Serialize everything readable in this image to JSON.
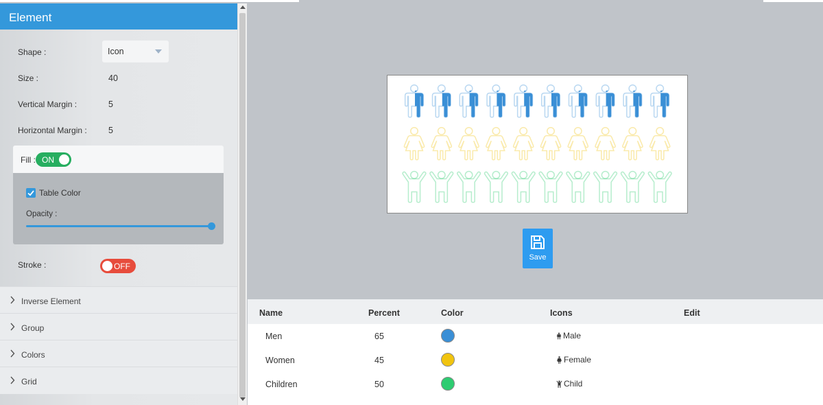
{
  "panel": {
    "title": "Element",
    "shape_label": "Shape :",
    "shape_value": "Icon",
    "size_label": "Size :",
    "size_value": "40",
    "vmargin_label": "Vertical Margin :",
    "vmargin_value": "5",
    "hmargin_label": "Horizontal Margin :",
    "hmargin_value": "5",
    "fill_label": "Fill :",
    "fill_toggle": "ON",
    "table_color_label": "Table Color",
    "table_color_checked": true,
    "opacity_label": "Opacity :",
    "opacity_value": 1.0,
    "stroke_label": "Stroke :",
    "stroke_toggle": "OFF",
    "sections": [
      "Inverse Element",
      "Group",
      "Colors",
      "Grid"
    ]
  },
  "save_label": "Save",
  "table": {
    "headers": [
      "Name",
      "Percent",
      "Color",
      "Icons",
      "Edit"
    ],
    "rows": [
      {
        "name": "Men",
        "percent": "65",
        "color": "#3a8fd6",
        "icon": "Male",
        "icon_name": "male-icon"
      },
      {
        "name": "Women",
        "percent": "45",
        "color": "#f1c40f",
        "icon": "Female",
        "icon_name": "female-icon"
      },
      {
        "name": "Children",
        "percent": "50",
        "color": "#2ecc71",
        "icon": "Child",
        "icon_name": "child-icon"
      }
    ]
  },
  "chart_data": {
    "type": "pictogram",
    "icons_per_row": 10,
    "series": [
      {
        "name": "Men",
        "value": 65,
        "color": "#3a8fd6",
        "icon": "male-icon"
      },
      {
        "name": "Women",
        "value": 45,
        "color": "#f1c40f",
        "icon": "female-icon"
      },
      {
        "name": "Children",
        "value": 50,
        "color": "#2ecc71",
        "icon": "child-icon"
      }
    ]
  },
  "colors": {
    "accent": "#3498db",
    "toggle_on": "#27ae60",
    "toggle_off": "#e74c3c"
  }
}
